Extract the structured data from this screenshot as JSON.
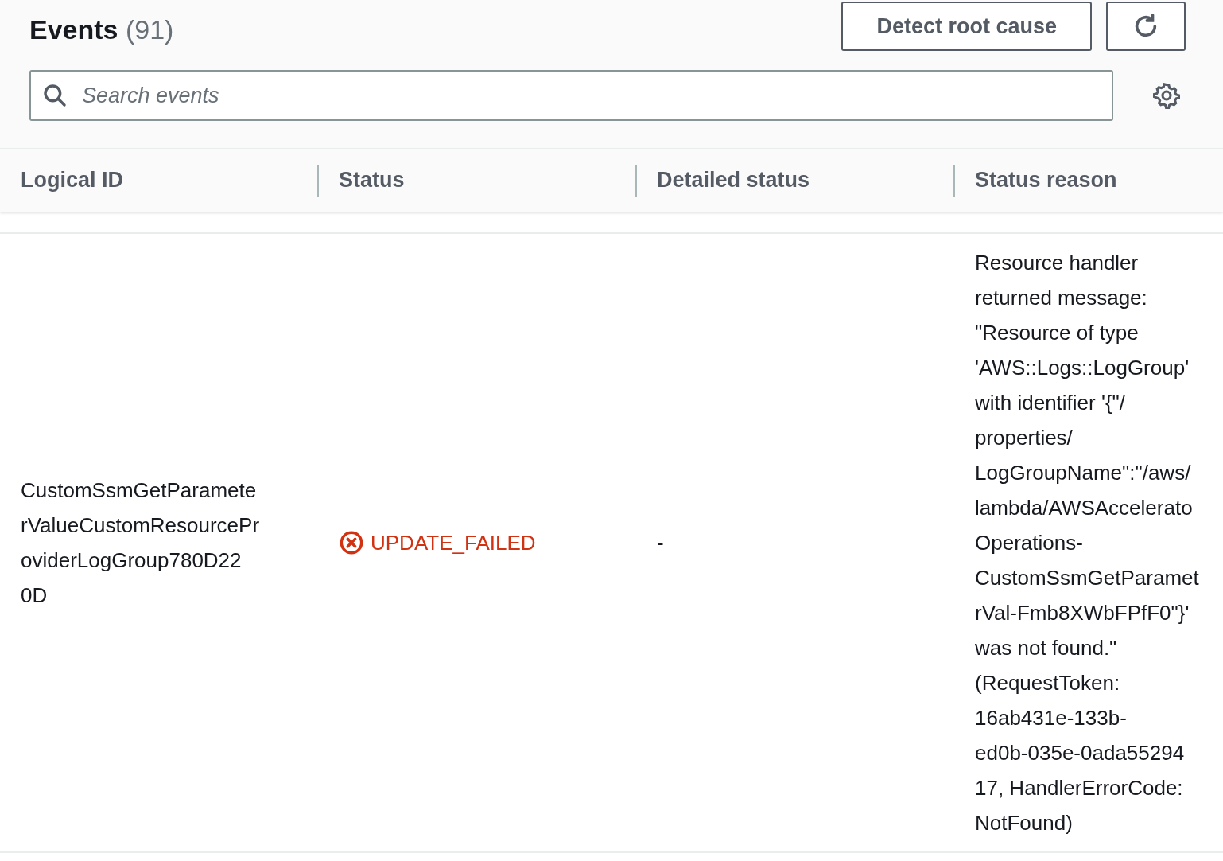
{
  "header": {
    "title": "Events",
    "count": "(91)",
    "buttons": [
      {
        "kind": "text",
        "label": "Detect root cause"
      },
      {
        "kind": "refresh"
      }
    ]
  },
  "search": {
    "placeholder": "Search events"
  },
  "table": {
    "columns": [
      "Logical ID",
      "Status",
      "Detailed status",
      "Status reason"
    ],
    "rows": [
      {
        "logical_id": [
          "CustomSsmGetParamete",
          "rValueCustomResourcePr",
          "oviderLogGroup780D22",
          "0D"
        ],
        "status": {
          "kind": "error",
          "label": "UPDATE_FAILED"
        },
        "detailed_status": "-",
        "status_reason": [
          "Resource handler",
          "returned message:",
          "\"Resource of type",
          "'AWS::Logs::LogGroup'",
          "with identifier '{\"/",
          "properties/",
          "LogGroupName\":\"/aws/",
          "lambda/AWSAccelerato",
          "Operations-",
          "CustomSsmGetParamet",
          "rVal-Fmb8XWbFPfF0\"}'",
          "was not found.\"",
          "(RequestToken:",
          "16ab431e-133b-",
          "ed0b-035e-0ada55294",
          "17, HandlerErrorCode:",
          "NotFound)"
        ]
      }
    ]
  }
}
